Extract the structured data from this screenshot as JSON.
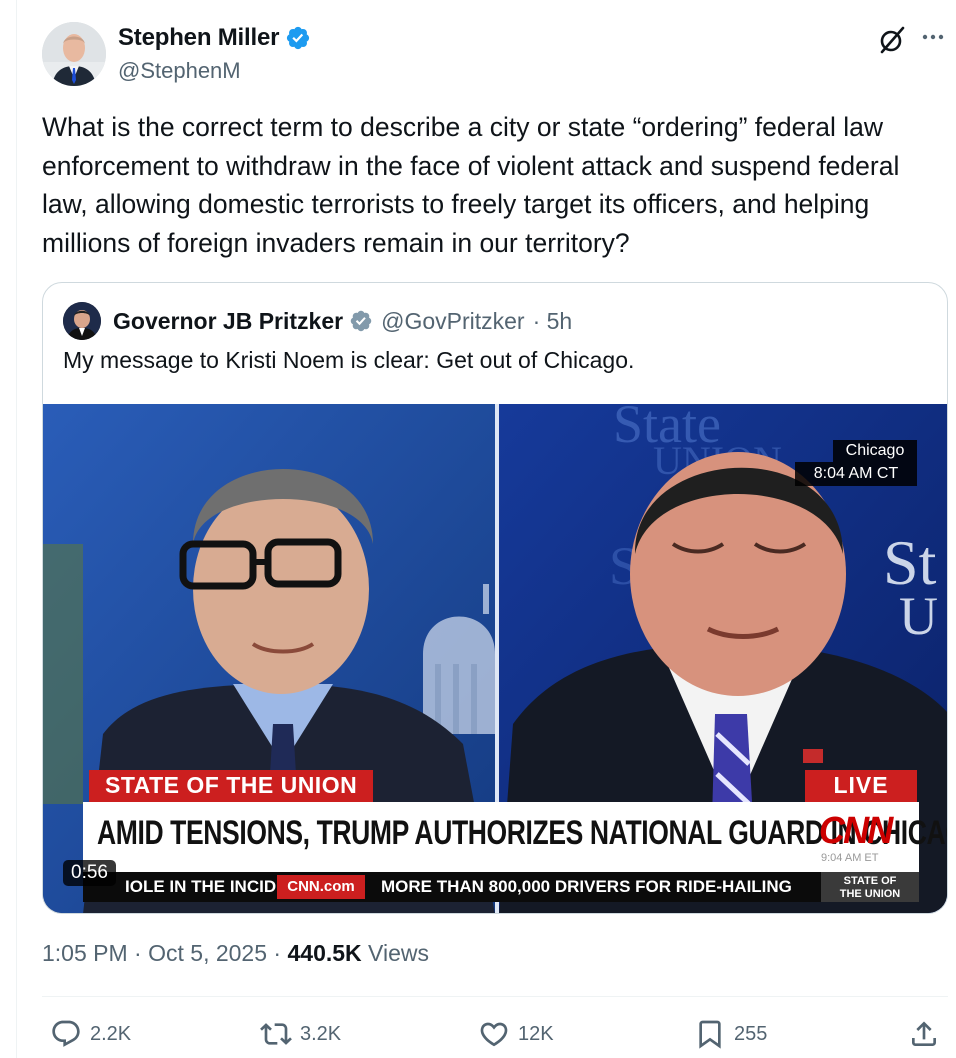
{
  "author": {
    "display_name": "Stephen Miller",
    "handle": "@StephenM",
    "verified_color": "#1d9bf0",
    "avatar_icon": "person-avatar"
  },
  "tweet_text": "What is the correct term to describe a city or state “ordering” federal law enforcement to withdraw in the face of violent attack and suspend federal law, allowing domestic terrorists to freely target its officers, and helping millions of foreign invaders remain in our territory?",
  "quote": {
    "display_name": "Governor JB Pritzker",
    "handle": "@GovPritzker",
    "time": "· 5h",
    "verified_color": "#829aab",
    "text": "My message to Kristi Noem is clear: Get out of Chicago.",
    "video": {
      "duration": "0:56",
      "show_tag": "STATE OF THE UNION",
      "live_tag": "LIVE",
      "headline": "AMID TENSIONS, TRUMP AUTHORIZES NATIONAL GUARD IN CHICAGO",
      "network_logo": "CNN",
      "small_time": "9:04 AM ET",
      "location": "Chicago",
      "local_time": "8:04 AM CT",
      "ticker_left": "IOLE IN THE INCIDENT.",
      "ticker_brand": "CNN.com",
      "ticker_right": "MORE THAN 800,000 DRIVERS FOR RIDE-HAILING",
      "ticker_show_line1": "STATE OF",
      "ticker_show_line2": "THE UNION"
    }
  },
  "meta": {
    "time": "1:05 PM",
    "sep1": " · ",
    "date": "Oct 5, 2025",
    "sep2": " · ",
    "views_count": "440.5K",
    "views_label": " Views"
  },
  "actions": {
    "replies": "2.2K",
    "reposts": "3.2K",
    "likes": "12K",
    "bookmarks": "255"
  },
  "colors": {
    "text": "#0f1419",
    "secondary": "#536471",
    "border": "#cfd9de",
    "cnn_red": "#cc1f1f"
  }
}
